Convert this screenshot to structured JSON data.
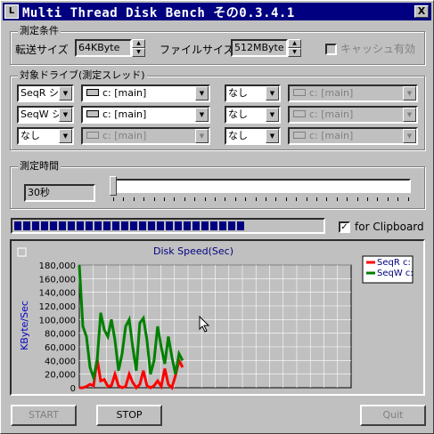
{
  "window": {
    "title": "Multi Thread Disk Bench その0.3.4.1",
    "close_glyph": "X",
    "icon_glyph": "L"
  },
  "conditions": {
    "group_label": "測定条件",
    "transfer_label": "転送サイズ",
    "transfer_value": "64KByte",
    "file_label": "ファイルサイズ",
    "file_value": "512MByte",
    "cache_label": "キャッシュ有効",
    "cache_checked": false
  },
  "drives": {
    "group_label": "対象ドライブ(測定スレッド)",
    "rows": [
      {
        "mode": "SeqR シ",
        "drive": "c: [main]",
        "mode2": "なし",
        "drive2": "c: [main]"
      },
      {
        "mode": "SeqW シ",
        "drive": "c: [main]",
        "mode2": "なし",
        "drive2": "c: [main]"
      },
      {
        "mode": "なし",
        "drive": "c: [main]",
        "mode2": "なし",
        "drive2": "c: [main]"
      }
    ]
  },
  "time": {
    "group_label": "測定時間",
    "value": "30秒"
  },
  "progress": {
    "blocks_filled": 26
  },
  "clipboard": {
    "label": "for Clipboard",
    "checked": true
  },
  "buttons": {
    "start": "START",
    "stop": "STOP",
    "quit": "Quit"
  },
  "colors": {
    "titlebar": "#000080",
    "seqr": "#ff0000",
    "seqw": "#008000",
    "plot_bg": "#c0c0c0"
  },
  "chart_data": {
    "type": "line",
    "title": "Disk Speed(Sec)",
    "ylabel": "KByte/Sec",
    "xlabel": "",
    "ylim": [
      0,
      180000
    ],
    "yticks": [
      "180,000",
      "160,000",
      "140,000",
      "120,000",
      "100,000",
      "80,000",
      "60,000",
      "40,000",
      "20,000",
      "0"
    ],
    "grid": true,
    "legend_position": "top-right",
    "x": [
      0,
      1,
      2,
      3,
      4,
      5,
      6,
      7,
      8,
      9,
      10,
      11,
      12,
      13,
      14,
      15,
      16,
      17,
      18,
      19,
      20,
      21,
      22,
      23,
      24,
      25,
      26,
      27,
      28,
      29
    ],
    "series": [
      {
        "name": "SeqR c:",
        "color": "#ff0000",
        "values": [
          0,
          0,
          2000,
          5000,
          3000,
          42000,
          10000,
          12000,
          2000,
          3000,
          20000,
          3000,
          0,
          2000,
          20000,
          8000,
          0,
          5000,
          25000,
          3000,
          0,
          3000,
          10000,
          2000,
          28000,
          5000,
          0,
          18000,
          40000,
          30000
        ]
      },
      {
        "name": "SeqW c:",
        "color": "#008000",
        "values": [
          185000,
          90000,
          75000,
          30000,
          15000,
          40000,
          110000,
          85000,
          75000,
          100000,
          70000,
          25000,
          50000,
          90000,
          100000,
          60000,
          25000,
          95000,
          102000,
          70000,
          20000,
          40000,
          90000,
          60000,
          35000,
          75000,
          45000,
          20000,
          50000,
          40000
        ]
      }
    ]
  }
}
